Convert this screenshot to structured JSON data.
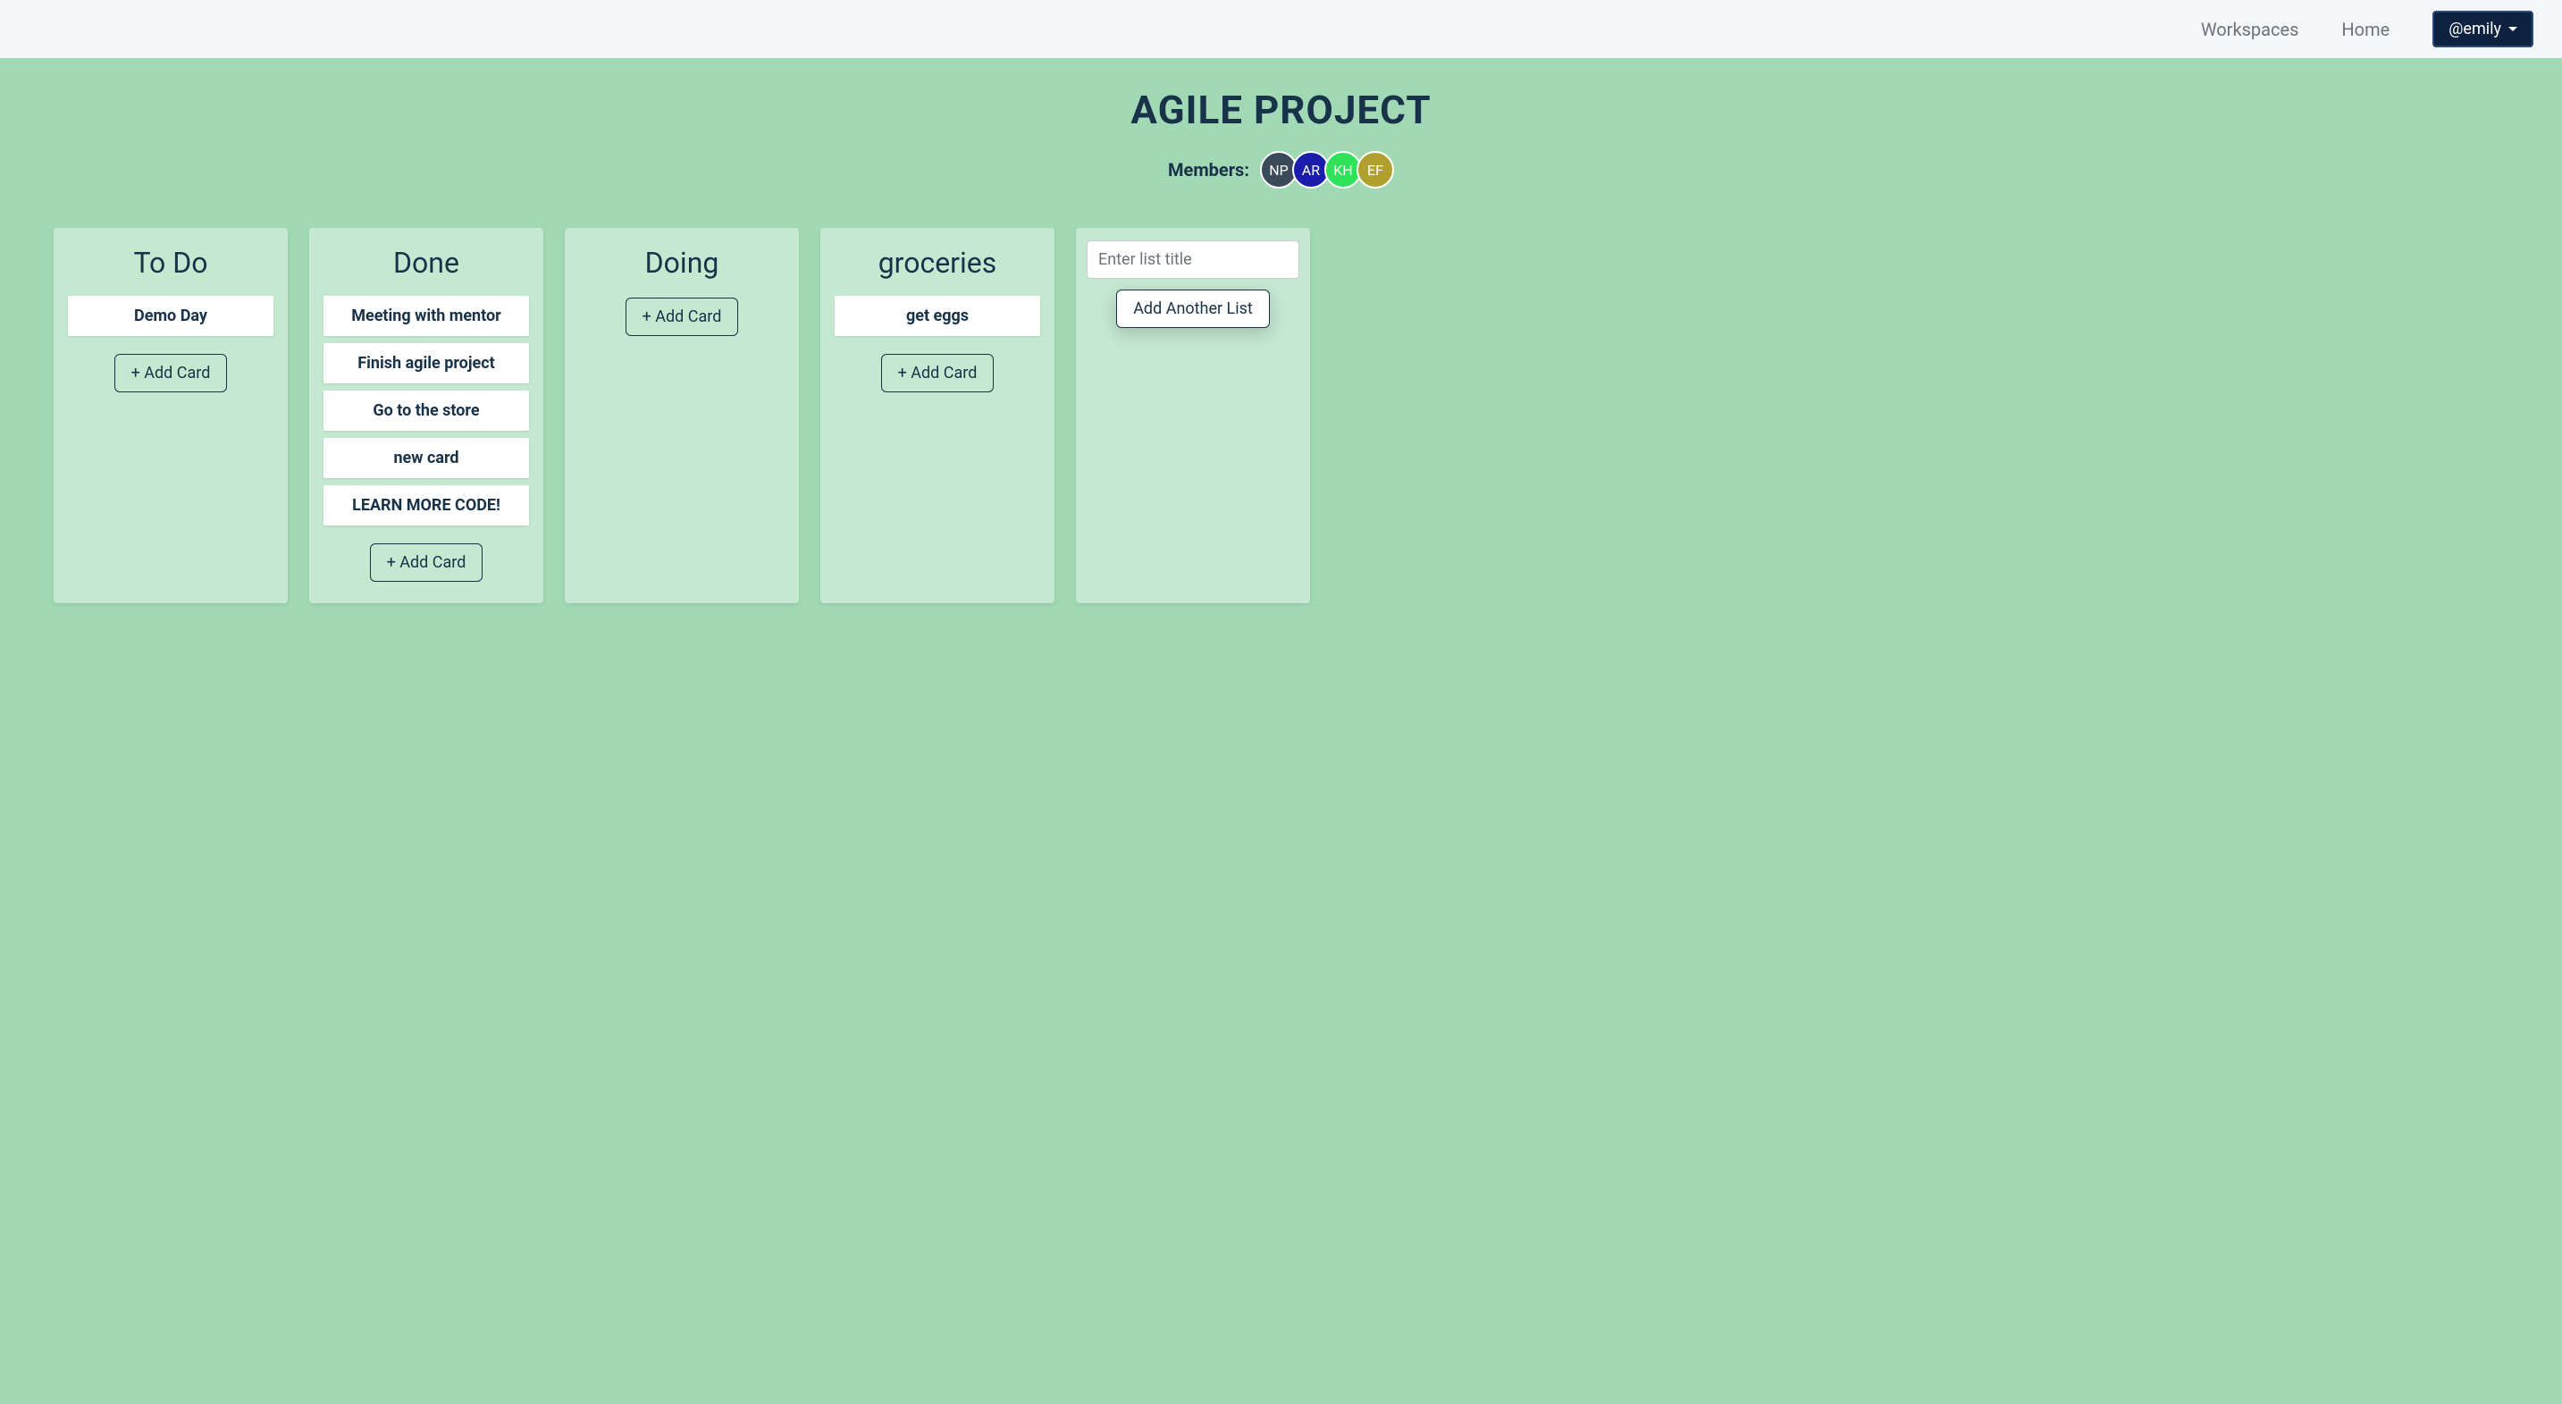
{
  "nav": {
    "workspaces": "Workspaces",
    "home": "Home",
    "user": "@emily"
  },
  "board": {
    "title": "AGILE PROJECT",
    "members_label": "Members:",
    "members": [
      {
        "initials": "NP",
        "color": "#3a4a58"
      },
      {
        "initials": "AR",
        "color": "#1a1dab"
      },
      {
        "initials": "KH",
        "color": "#2ee35a"
      },
      {
        "initials": "EF",
        "color": "#b0a02e"
      }
    ],
    "add_card_label": "+ Add Card",
    "columns": [
      {
        "title": "To Do",
        "cards": [
          "Demo Day"
        ]
      },
      {
        "title": "Done",
        "cards": [
          "Meeting with mentor",
          "Finish agile project",
          "Go to the store",
          "new card",
          "LEARN MORE CODE!"
        ]
      },
      {
        "title": "Doing",
        "cards": []
      },
      {
        "title": "groceries",
        "cards": [
          "get eggs"
        ]
      }
    ],
    "new_list": {
      "placeholder": "Enter list title",
      "button": "Add Another List"
    }
  }
}
